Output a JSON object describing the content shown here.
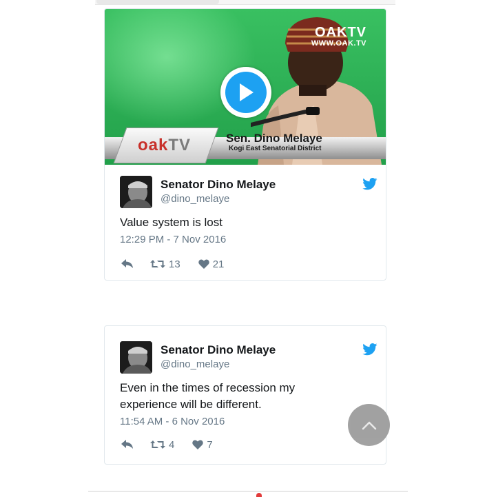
{
  "media": {
    "watermark_logo": "OAKTV",
    "watermark_url": "WWW.OAK.TV",
    "lower_third_logo_main": "oak",
    "lower_third_logo_accent": "TV",
    "lower_third_name": "Sen. Dino Melaye",
    "lower_third_subtitle": "Kogi East Senatorial District",
    "play_icon": "play-icon"
  },
  "tweets": [
    {
      "author_name": "Senator Dino Melaye",
      "author_handle": "@dino_melaye",
      "text": "Value system is lost",
      "timestamp": "12:29 PM - 7 Nov 2016",
      "retweets": "13",
      "likes": "21"
    },
    {
      "author_name": "Senator Dino Melaye",
      "author_handle": "@dino_melaye",
      "text": "Even in the times of recession my experience will be different.",
      "timestamp": "11:54 AM - 6 Nov 2016",
      "retweets": "4",
      "likes": "7"
    }
  ],
  "icons": {
    "reply": "reply-icon",
    "retweet": "retweet-icon",
    "like": "heart-icon",
    "brand": "twitter-bird-icon",
    "scroll_top": "chevron-up-icon"
  },
  "colors": {
    "twitter_blue": "#1da1f2",
    "muted_text": "#657786",
    "primary_text": "#14171a",
    "card_border": "#e1e8ed",
    "video_green": "#2fb257",
    "scroll_button": "#9a9a9a"
  }
}
